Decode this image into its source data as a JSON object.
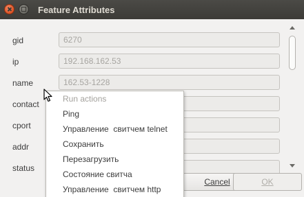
{
  "window": {
    "title": "Feature Attributes"
  },
  "fields": [
    {
      "label": "gid",
      "value": "6270"
    },
    {
      "label": "ip",
      "value": "192.168.162.53"
    },
    {
      "label": "name",
      "value": "162.53-1228"
    },
    {
      "label": "contact",
      "value": ""
    },
    {
      "label": "cport",
      "value": ""
    },
    {
      "label": "addr",
      "value": ""
    },
    {
      "label": "status",
      "value": ""
    }
  ],
  "menu": {
    "items": [
      {
        "label": "Run actions",
        "enabled": false
      },
      {
        "label": "Ping",
        "enabled": true
      },
      {
        "label": "Управление  свитчем telnet",
        "enabled": true
      },
      {
        "label": "Сохранить",
        "enabled": true
      },
      {
        "label": "Перезагрузить",
        "enabled": true
      },
      {
        "label": "Состояние свитча",
        "enabled": true
      },
      {
        "label": "Управление  свитчем http",
        "enabled": true
      }
    ]
  },
  "buttons": {
    "cancel": "Cancel",
    "ok": "OK"
  },
  "icons": {
    "close": "close-icon",
    "minimize": "minimize-icon",
    "cursor": "mouse-pointer-icon"
  }
}
